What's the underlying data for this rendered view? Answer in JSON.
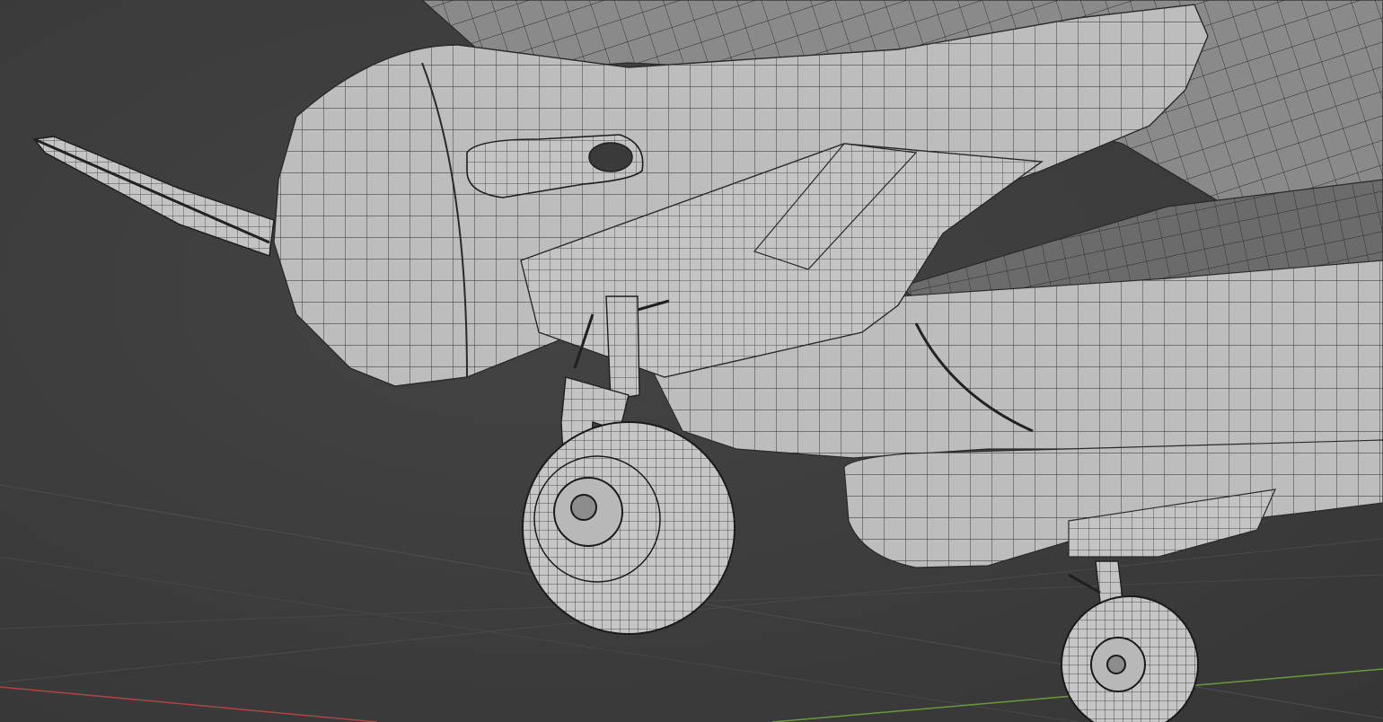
{
  "viewport": {
    "mode": "wireframe-overlay",
    "background_color": "#3d3d3d",
    "grid": "on",
    "x_axis_color": "#b04444",
    "y_axis_color": "#6a9a3a",
    "surface_color": "#b8b8b8",
    "wire_color": "#2a2a2a"
  },
  "scene": {
    "objects": [
      {
        "icon": "propeller-blade-icon"
      },
      {
        "icon": "engine-cowling-icon"
      },
      {
        "icon": "exhaust-pipe-icon"
      },
      {
        "icon": "wing-underside-icon"
      },
      {
        "icon": "fuselage-icon"
      },
      {
        "icon": "main-landing-gear-icon"
      },
      {
        "icon": "second-landing-gear-icon"
      },
      {
        "icon": "drop-tank-icon"
      }
    ]
  }
}
